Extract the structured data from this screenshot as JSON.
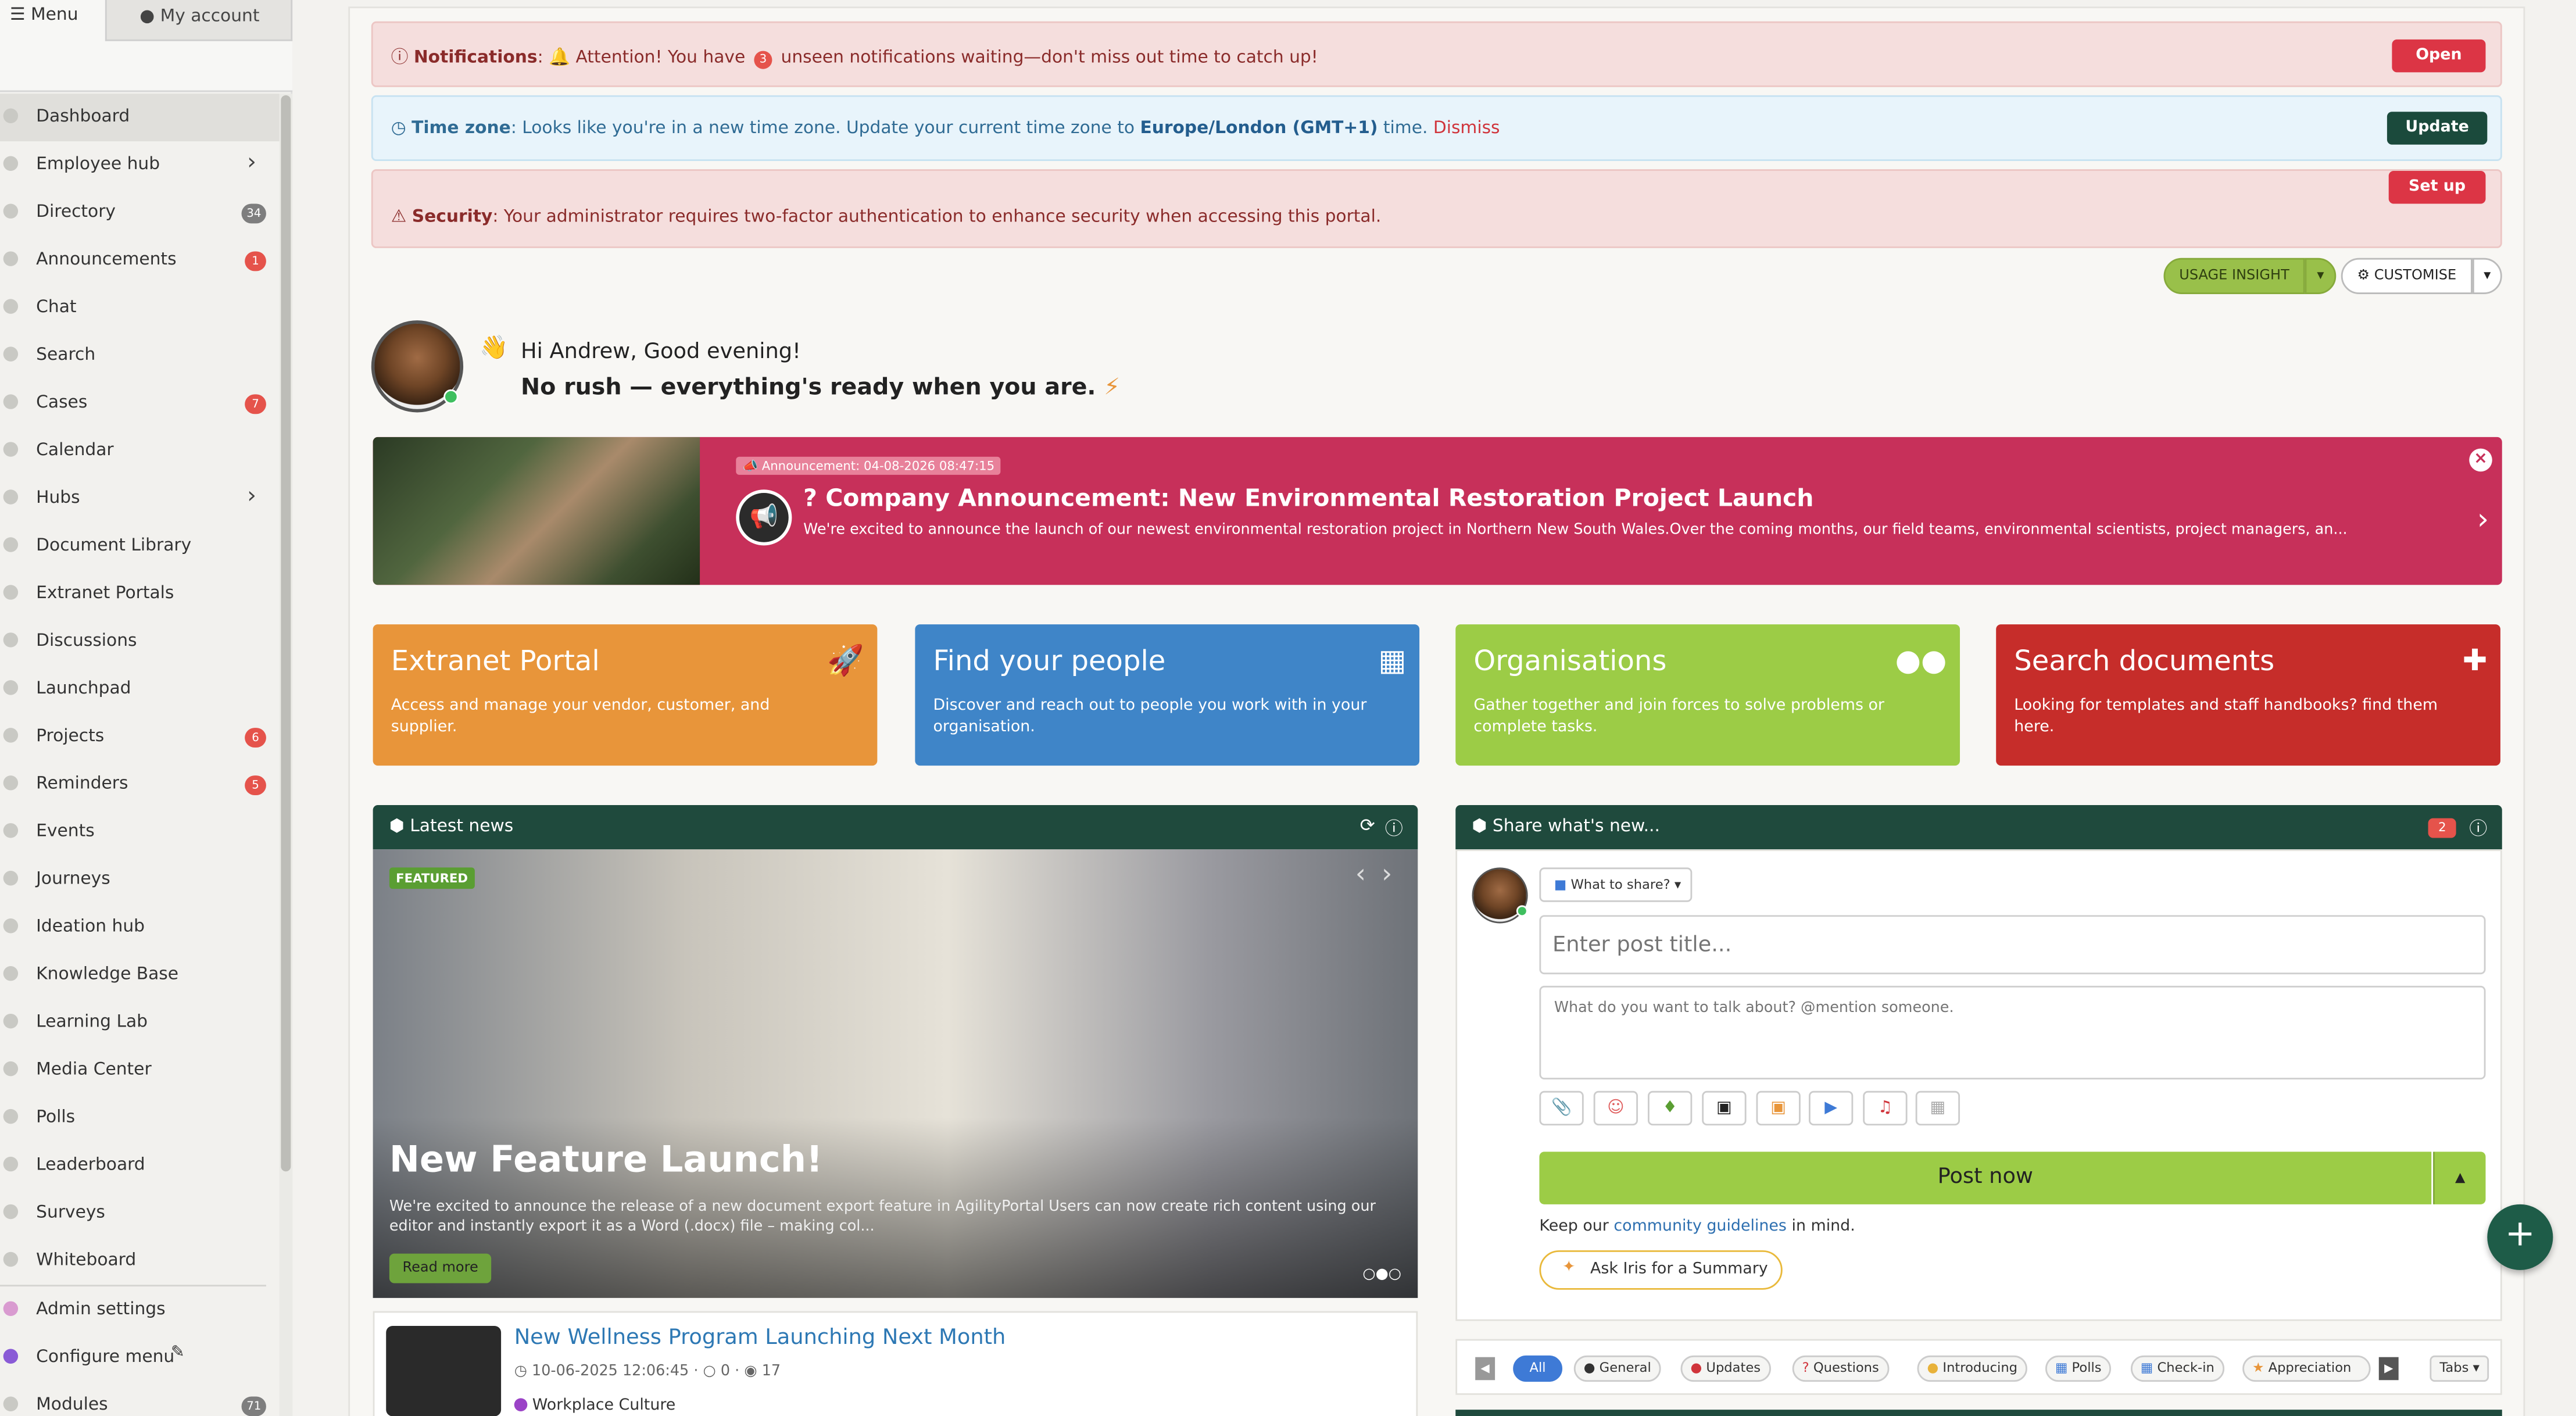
{
  "topbar": {
    "menu_label": "Menu",
    "account_label": "My account"
  },
  "sidebar": {
    "items": [
      {
        "label": "Dashboard"
      },
      {
        "label": "Employee hub"
      },
      {
        "label": "Directory",
        "count": "34"
      },
      {
        "label": "Announcements",
        "count": "1"
      },
      {
        "label": "Chat"
      },
      {
        "label": "Search"
      },
      {
        "label": "Cases",
        "count": "7"
      },
      {
        "label": "Calendar"
      },
      {
        "label": "Hubs"
      },
      {
        "label": "Document Library"
      },
      {
        "label": "Extranet Portals"
      },
      {
        "label": "Discussions"
      },
      {
        "label": "Launchpad"
      },
      {
        "label": "Projects",
        "count": "6"
      },
      {
        "label": "Reminders",
        "count": "5"
      },
      {
        "label": "Events"
      },
      {
        "label": "Journeys"
      },
      {
        "label": "Ideation hub"
      },
      {
        "label": "Knowledge Base"
      },
      {
        "label": "Learning Lab"
      },
      {
        "label": "Media Center"
      },
      {
        "label": "Polls"
      },
      {
        "label": "Leaderboard"
      },
      {
        "label": "Surveys"
      },
      {
        "label": "Whiteboard"
      },
      {
        "label": "Admin settings"
      },
      {
        "label": "Configure menu"
      },
      {
        "label": "Modules",
        "count": "71"
      }
    ]
  },
  "alerts": {
    "notifications": {
      "label": "Notifications",
      "pre": "Attention! You have",
      "count": "3",
      "post": "unseen notifications waiting—don't miss out time to catch up!",
      "button": "Open"
    },
    "timezone": {
      "label": "Time zone",
      "text": ": Looks like you're in a new time zone. Update your current time zone to",
      "zone": "Europe/London (GMT+1)",
      "suffix": "time.",
      "dismiss": "Dismiss",
      "button": "Update"
    },
    "security": {
      "label": "Security",
      "text": ": Your administrator requires two-factor authentication to enhance security when accessing this portal.",
      "button": "Set up"
    }
  },
  "toolbar": {
    "usage_insight": "USAGE INSIGHT",
    "customise": "CUSTOMISE"
  },
  "greeting": {
    "line1": "Hi Andrew, Good evening!",
    "line2": "No rush — everything's ready when you are."
  },
  "announcement": {
    "tag": "Announcement: 04-08-2026 08:47:15",
    "title": "? Company Announcement: New Environmental Restoration Project Launch",
    "body": "We're excited to announce the launch of our newest environmental restoration project in Northern New South Wales.Over the coming months, our field teams, environmental scientists, project managers, an..."
  },
  "tiles": [
    {
      "title": "Extranet Portal",
      "desc": "Access and manage your vendor, customer, and supplier.",
      "color": "#e8953a"
    },
    {
      "title": "Find your people",
      "desc": "Discover and reach out to people you work with in your organisation.",
      "color": "#3f85c8"
    },
    {
      "title": "Organisations",
      "desc": "Gather together and join forces to solve problems or complete tasks.",
      "color": "#9ccc46"
    },
    {
      "title": "Search documents",
      "desc": "Looking for templates and staff handbooks? find them here.",
      "color": "#c62d2a"
    }
  ],
  "news": {
    "header": "Latest news",
    "featured_tag": "FEATURED",
    "title": "New Feature Launch!",
    "text": "We're excited to announce the release of a new document export feature in AgilityPortal Users can now create rich content using our editor and instantly export it as a Word (.docx) file – making col...",
    "read_more": "Read more",
    "item": {
      "title": "New Wellness Program Launching Next Month",
      "date": "10-06-2025 12:06:45",
      "comments": "0",
      "views": "17",
      "category": "Workplace Culture"
    }
  },
  "share": {
    "header": "Share what's new...",
    "badge": "2",
    "what_to_share": "What to share?",
    "title_placeholder": "Enter post title...",
    "body_placeholder": "What do you want to talk about? @mention someone.",
    "post_button": "Post now",
    "guidelines_pre": "Keep our",
    "guidelines_link": "community guidelines",
    "guidelines_post": "in mind.",
    "ask_iris": "Ask Iris for a Summary"
  },
  "feed_tabs": [
    "All",
    "General",
    "Updates",
    "Questions",
    "Introducing",
    "Polls",
    "Check-in",
    "Appreciation"
  ],
  "feed_tabs_menu": "Tabs"
}
